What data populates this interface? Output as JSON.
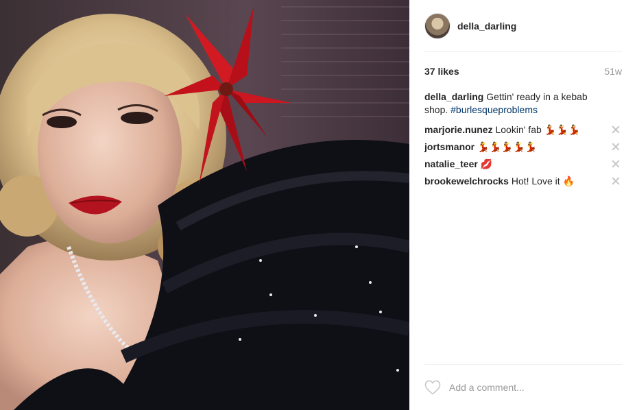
{
  "post": {
    "author": "della_darling",
    "likes": "37 likes",
    "age": "51w",
    "caption": {
      "user": "della_darling",
      "text": "Gettin' ready in a kebab shop.",
      "hashtag": "#burlesqueproblems"
    },
    "comments": [
      {
        "user": "marjorie.nunez",
        "text": "Lookin' fab",
        "emoji": "💃💃💃",
        "emoji_kind": "dancer"
      },
      {
        "user": "jortsmanor",
        "text": "",
        "emoji": "💃💃💃💃💃",
        "emoji_kind": "dancer"
      },
      {
        "user": "natalie_teer",
        "text": "",
        "emoji": "💋",
        "emoji_kind": "lips"
      },
      {
        "user": "brookewelchrocks",
        "text": "Hot! Love it",
        "emoji": "🔥",
        "emoji_kind": "fire"
      }
    ],
    "comment_placeholder": "Add a comment..."
  },
  "icons": {
    "like": "heart-outline-icon",
    "delete_comment": "close-x-icon"
  },
  "colors": {
    "hashtag": "#003569",
    "muted": "#999999",
    "text": "#262626",
    "divider": "#efefef"
  }
}
